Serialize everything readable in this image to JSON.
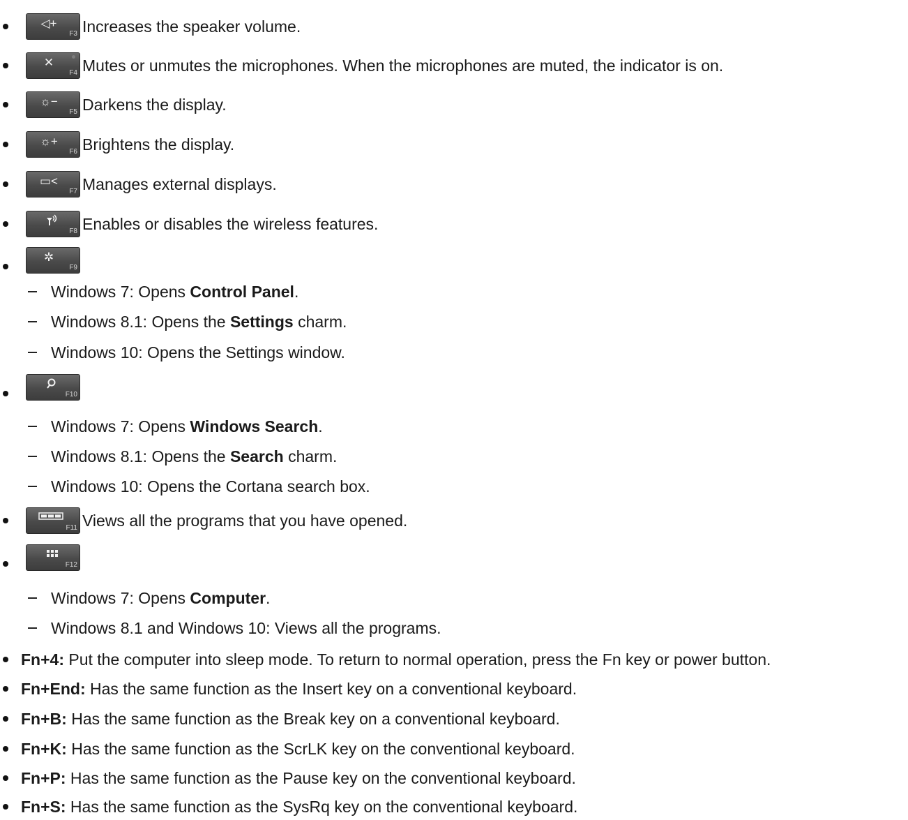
{
  "keys": [
    {
      "glyph": "◁+",
      "fkey": "F3",
      "desc": "Increases the speaker volume."
    },
    {
      "glyph": "✕",
      "fkey": "F4",
      "desc": "Mutes or unmutes the microphones. When the microphones are muted, the indicator is on."
    },
    {
      "glyph": "☼−",
      "fkey": "F5",
      "desc": "Darkens the display."
    },
    {
      "glyph": "☼+",
      "fkey": "F6",
      "desc": "Brightens the display."
    },
    {
      "glyph": "▭<",
      "fkey": "F7",
      "desc": "Manages external displays."
    },
    {
      "glyph": "",
      "fkey": "F8",
      "desc": "Enables or disables the wireless features."
    },
    {
      "glyph": "✲",
      "fkey": "F9",
      "desc": ""
    },
    {
      "glyph": "",
      "fkey": "F10",
      "desc": ""
    },
    {
      "glyph": "",
      "fkey": "F11",
      "desc": "Views all the programs that you have opened."
    },
    {
      "glyph": "",
      "fkey": "F12",
      "desc": ""
    }
  ],
  "f9_items": [
    {
      "pre": "Windows 7: Opens ",
      "bold": "Control Panel",
      "post": "."
    },
    {
      "pre": "Windows 8.1: Opens the ",
      "bold": "Settings",
      "post": " charm."
    },
    {
      "pre": "Windows 10: Opens the Settings window.",
      "bold": "",
      "post": ""
    }
  ],
  "f10_items": [
    {
      "pre": "Windows 7: Opens ",
      "bold": "Windows Search",
      "post": "."
    },
    {
      "pre": "Windows 8.1: Opens the ",
      "bold": "Search",
      "post": " charm."
    },
    {
      "pre": "Windows 10: Opens the Cortana search box.",
      "bold": "",
      "post": ""
    }
  ],
  "f12_items": [
    {
      "pre": "Windows 7: Opens ",
      "bold": "Computer",
      "post": "."
    },
    {
      "pre": "Windows 8.1 and Windows 10: Views all the programs.",
      "bold": "",
      "post": ""
    }
  ],
  "fn_combos": [
    {
      "key": "Fn+4:",
      "text": " Put the computer into sleep mode. To return to normal operation, press the Fn key or power button."
    },
    {
      "key": "Fn+End:",
      "text": " Has the same function as the Insert key on a conventional keyboard."
    },
    {
      "key": "Fn+B:",
      "text": " Has the same function as the Break key on a conventional keyboard."
    },
    {
      "key": "Fn+K:",
      "text": " Has the same function as the ScrLK key on the conventional keyboard."
    },
    {
      "key": "Fn+P:",
      "text": " Has the same function as the Pause key on the conventional keyboard."
    },
    {
      "key": "Fn+S:",
      "text": " Has the same function as the SysRq key on the conventional keyboard."
    }
  ]
}
